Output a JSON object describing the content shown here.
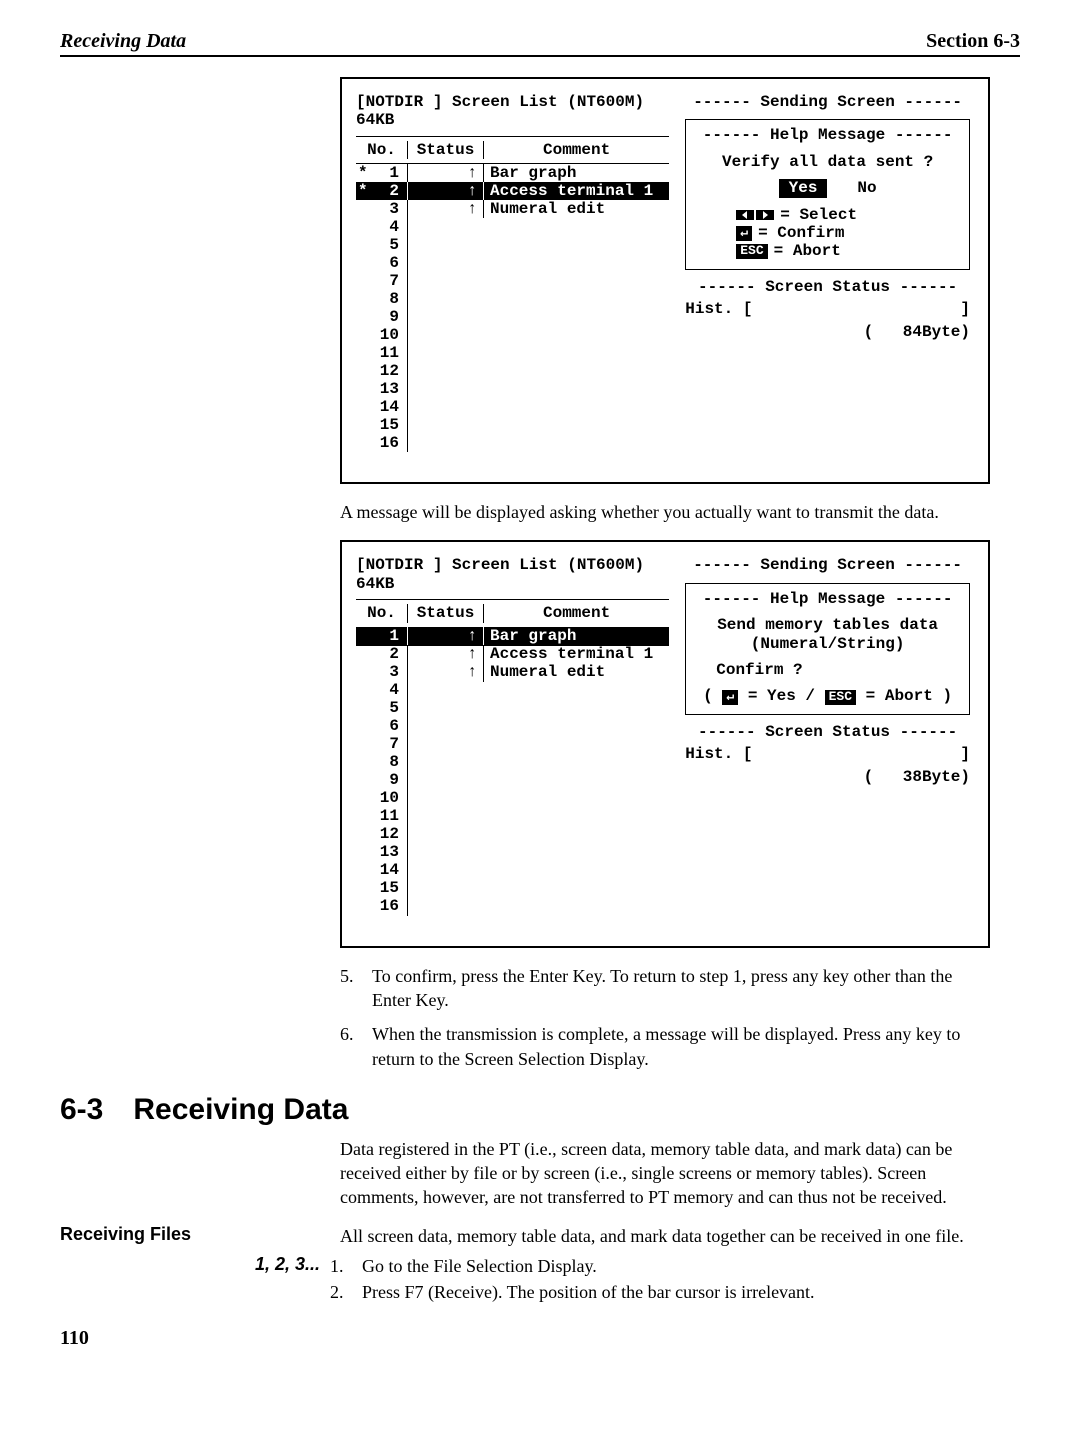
{
  "header": {
    "left": "Receiving Data",
    "right": "Section 6-3"
  },
  "screenshot1": {
    "title": "[NOTDIR  ]  Screen List (NT600M)     64KB",
    "table": {
      "no": "No.",
      "status": "Status",
      "comment": "Comment"
    },
    "rows": [
      {
        "marker": "*",
        "no": "1",
        "status": "↑",
        "comment": "Bar graph",
        "hl": false
      },
      {
        "marker": "*",
        "no": "2",
        "status": "↑",
        "comment": "Access terminal 1",
        "hl": true
      },
      {
        "marker": "",
        "no": "3",
        "status": "↑",
        "comment": "Numeral edit",
        "hl": false
      },
      {
        "marker": "",
        "no": "4",
        "status": "",
        "comment": "",
        "hl": false
      },
      {
        "marker": "",
        "no": "5",
        "status": "",
        "comment": "",
        "hl": false
      },
      {
        "marker": "",
        "no": "6",
        "status": "",
        "comment": "",
        "hl": false
      },
      {
        "marker": "",
        "no": "7",
        "status": "",
        "comment": "",
        "hl": false
      },
      {
        "marker": "",
        "no": "8",
        "status": "",
        "comment": "",
        "hl": false
      },
      {
        "marker": "",
        "no": "9",
        "status": "",
        "comment": "",
        "hl": false
      },
      {
        "marker": "",
        "no": "10",
        "status": "",
        "comment": "",
        "hl": false
      },
      {
        "marker": "",
        "no": "11",
        "status": "",
        "comment": "",
        "hl": false
      },
      {
        "marker": "",
        "no": "12",
        "status": "",
        "comment": "",
        "hl": false
      },
      {
        "marker": "",
        "no": "13",
        "status": "",
        "comment": "",
        "hl": false
      },
      {
        "marker": "",
        "no": "14",
        "status": "",
        "comment": "",
        "hl": false
      },
      {
        "marker": "",
        "no": "15",
        "status": "",
        "comment": "",
        "hl": false
      },
      {
        "marker": "",
        "no": "16",
        "status": "",
        "comment": "",
        "hl": false
      }
    ],
    "sending": "------   Sending Screen   ------",
    "help_title": "------   Help Message    ------",
    "verify": "Verify all data sent ?",
    "yes": "Yes",
    "no_label": "No",
    "k_select": " = Select",
    "k_confirm": " = Confirm",
    "k_abort": " = Abort",
    "status_title": "------   Screen Status   ------",
    "hist_label": "Hist. [",
    "hist_close": "]",
    "bytes_open": "(",
    "bytes": "84Byte)"
  },
  "caption1": "A message will be displayed asking whether you actually want to transmit the data.",
  "screenshot2": {
    "title": "[NOTDIR  ]  Screen List (NT600M)     64KB",
    "table": {
      "no": "No.",
      "status": "Status",
      "comment": "Comment"
    },
    "rows": [
      {
        "marker": "",
        "no": "1",
        "status": "↑",
        "comment": "Bar graph",
        "hl": true
      },
      {
        "marker": "",
        "no": "2",
        "status": "↑",
        "comment": "Access terminal 1",
        "hl": false
      },
      {
        "marker": "",
        "no": "3",
        "status": "↑",
        "comment": "Numeral edit",
        "hl": false
      },
      {
        "marker": "",
        "no": "4",
        "status": "",
        "comment": "",
        "hl": false
      },
      {
        "marker": "",
        "no": "5",
        "status": "",
        "comment": "",
        "hl": false
      },
      {
        "marker": "",
        "no": "6",
        "status": "",
        "comment": "",
        "hl": false
      },
      {
        "marker": "",
        "no": "7",
        "status": "",
        "comment": "",
        "hl": false
      },
      {
        "marker": "",
        "no": "8",
        "status": "",
        "comment": "",
        "hl": false
      },
      {
        "marker": "",
        "no": "9",
        "status": "",
        "comment": "",
        "hl": false
      },
      {
        "marker": "",
        "no": "10",
        "status": "",
        "comment": "",
        "hl": false
      },
      {
        "marker": "",
        "no": "11",
        "status": "",
        "comment": "",
        "hl": false
      },
      {
        "marker": "",
        "no": "12",
        "status": "",
        "comment": "",
        "hl": false
      },
      {
        "marker": "",
        "no": "13",
        "status": "",
        "comment": "",
        "hl": false
      },
      {
        "marker": "",
        "no": "14",
        "status": "",
        "comment": "",
        "hl": false
      },
      {
        "marker": "",
        "no": "15",
        "status": "",
        "comment": "",
        "hl": false
      },
      {
        "marker": "",
        "no": "16",
        "status": "",
        "comment": "",
        "hl": false
      }
    ],
    "sending": "------   Sending Screen   ------",
    "help_title": "------   Help Message    ------",
    "msg1": "Send memory tables data",
    "msg2": "(Numeral/String)",
    "msg3": "Confirm ?",
    "key_yes": " = Yes / ",
    "key_abort": " = Abort )",
    "key_open": "( ",
    "status_title": "------   Screen Status   ------",
    "hist_label": "Hist. [",
    "hist_close": "]",
    "bytes_open": "(",
    "bytes": "38Byte)"
  },
  "step5": "To confirm, press the Enter Key. To return to step 1, press any key other than the Enter Key.",
  "step6": "When the transmission is complete, a message will be displayed. Press any key to return to the Screen Selection Display.",
  "section": {
    "num": "6-3",
    "title": "Receiving Data"
  },
  "section_intro": "Data registered in the PT (i.e., screen data, memory table data, and mark data) can be received either by file or by screen (i.e., single screens or memory tables). Screen comments, however, are not transferred to PT memory and can thus not be received.",
  "recv_files": {
    "label": "Receiving Files",
    "text": "All screen data, memory table data, and mark data together can be received in one file."
  },
  "steps_tag": "1, 2, 3...",
  "substep1": "Go to the File Selection Display.",
  "substep2": "Press F7 (Receive). The position of the bar cursor is irrelevant.",
  "page_number": "110",
  "nums": {
    "n5": "5.",
    "n6": "6.",
    "s1": "1.",
    "s2": "2."
  },
  "esc_label": "ESC",
  "enter_glyph": "↵"
}
